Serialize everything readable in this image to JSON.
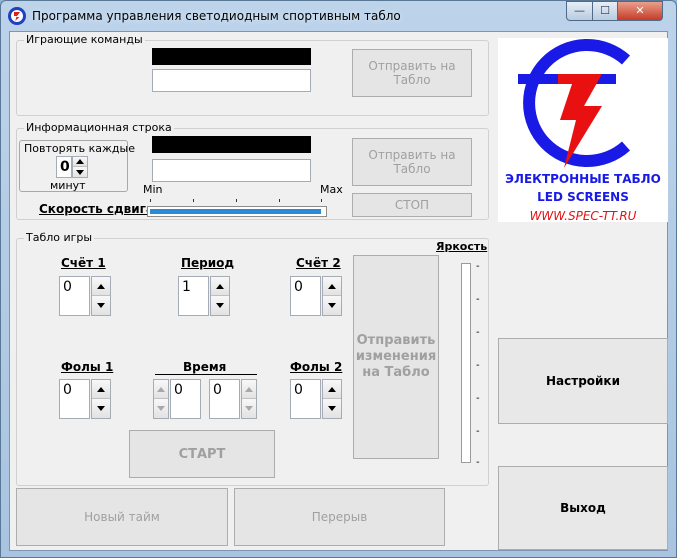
{
  "window": {
    "title": "Программа управления светодиодным спортивным табло",
    "minimize_glyph": "—",
    "maximize_glyph": "☐",
    "close_glyph": "✕"
  },
  "teams": {
    "title": "Играющие команды",
    "send_label": "Отправить на Табло"
  },
  "info": {
    "title": "Информационная строка",
    "repeat_label": "Повторять каждые",
    "repeat_value": "0",
    "minutes_label": "минут",
    "send_label": "Отправить на Табло",
    "stop_label": "СТОП",
    "speed_label": "Скорость сдвига",
    "min_label": "Min",
    "max_label": "Max",
    "speed_fraction": 0.98
  },
  "logo": {
    "line1": "ЭЛЕКТРОННЫЕ ТАБЛО",
    "line2": "LED SCREENS",
    "line3": "WWW.SPEC-TT.RU",
    "blue": "#1a1ae6",
    "red": "#e81010"
  },
  "game": {
    "title": "Табло игры",
    "brightness_label": "Яркость",
    "score1_label": "Счёт 1",
    "score1_value": "0",
    "period_label": "Период",
    "period_value": "1",
    "score2_label": "Счёт 2",
    "score2_value": "0",
    "fouls1_label": "Фолы 1",
    "fouls1_value": "0",
    "time_label": "Время",
    "time_minutes": "0",
    "time_seconds": "0",
    "fouls2_label": "Фолы 2",
    "fouls2_value": "0",
    "send_changes_label": "Отправить изменения на Табло",
    "start_label": "СТАРТ",
    "brightness_tick": "-"
  },
  "buttons": {
    "settings_label": "Настройки",
    "exit_label": "Выход",
    "new_half_label": "Новый тайм",
    "break_label": "Перерыв"
  }
}
